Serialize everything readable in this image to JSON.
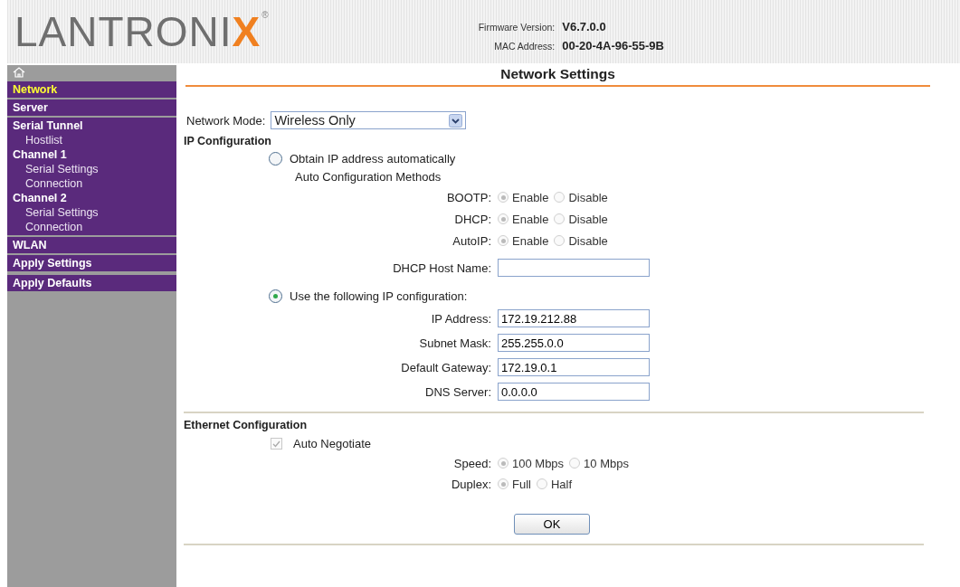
{
  "header": {
    "logo": {
      "text": "LANTRONI",
      "accent": "X",
      "mark": "®"
    },
    "info": [
      {
        "label": "Firmware Version:",
        "value": "V6.7.0.0"
      },
      {
        "label": "MAC Address:",
        "value": "00-20-4A-96-55-9B"
      }
    ]
  },
  "sidebar": {
    "groups": [
      [
        {
          "label": "Network",
          "selected": true
        }
      ],
      [
        {
          "label": "Server",
          "selected": false
        }
      ],
      [
        {
          "label": "Serial Tunnel",
          "selected": false,
          "children": [
            {
              "label": "Hostlist",
              "selected": false
            }
          ]
        },
        {
          "label": "Channel 1",
          "selected": false,
          "children": [
            {
              "label": "Serial Settings",
              "selected": false
            },
            {
              "label": "Connection",
              "selected": false
            }
          ]
        },
        {
          "label": "Channel 2",
          "selected": false,
          "children": [
            {
              "label": "Serial Settings",
              "selected": false
            },
            {
              "label": "Connection",
              "selected": false
            }
          ]
        }
      ],
      [
        {
          "label": "WLAN",
          "selected": false
        }
      ],
      [
        {
          "label": "Apply Settings",
          "selected": false
        }
      ],
      [
        {
          "label": "Apply Defaults",
          "selected": false
        }
      ]
    ]
  },
  "content": {
    "title": "Network Settings",
    "network_mode": {
      "label": "Network Mode:",
      "value": "Wireless Only"
    },
    "ip_configuration": {
      "heading": "IP Configuration",
      "options": [
        {
          "label": "Obtain IP address automatically",
          "selected": false
        },
        {
          "label": "Use the following IP configuration:",
          "selected": true
        }
      ],
      "auto_methods": {
        "heading": "Auto Configuration Methods",
        "rows": [
          {
            "label": "BOOTP:",
            "disabled": true,
            "choices": [
              {
                "label": "Enable",
                "selected": true
              },
              {
                "label": "Disable",
                "selected": false
              }
            ]
          },
          {
            "label": "DHCP:",
            "disabled": true,
            "choices": [
              {
                "label": "Enable",
                "selected": true
              },
              {
                "label": "Disable",
                "selected": false
              }
            ]
          },
          {
            "label": "AutoIP:",
            "disabled": true,
            "choices": [
              {
                "label": "Enable",
                "selected": true
              },
              {
                "label": "Disable",
                "selected": false
              }
            ]
          }
        ]
      },
      "host_name": {
        "label": "DHCP Host Name:"
      },
      "fields": [
        {
          "label": "IP Address:",
          "value": "172.19.212.88"
        },
        {
          "label": "Subnet Mask:",
          "value": "255.255.0.0"
        },
        {
          "label": "Default Gateway:",
          "value": "172.19.0.1"
        },
        {
          "label": "DNS Server:",
          "value": "0.0.0.0"
        }
      ]
    },
    "ethernet": {
      "heading": "Ethernet Configuration",
      "auto_negotiate": {
        "label": "Auto Negotiate",
        "checked": true,
        "disabled": true
      },
      "rows": [
        {
          "label": "Speed:",
          "disabled": true,
          "choices": [
            {
              "label": "100 Mbps",
              "selected": true
            },
            {
              "label": "10 Mbps",
              "selected": false
            }
          ]
        },
        {
          "label": "Duplex:",
          "disabled": true,
          "choices": [
            {
              "label": "Full",
              "selected": true
            },
            {
              "label": "Half",
              "selected": false
            }
          ]
        }
      ]
    },
    "ok_button": "OK"
  }
}
